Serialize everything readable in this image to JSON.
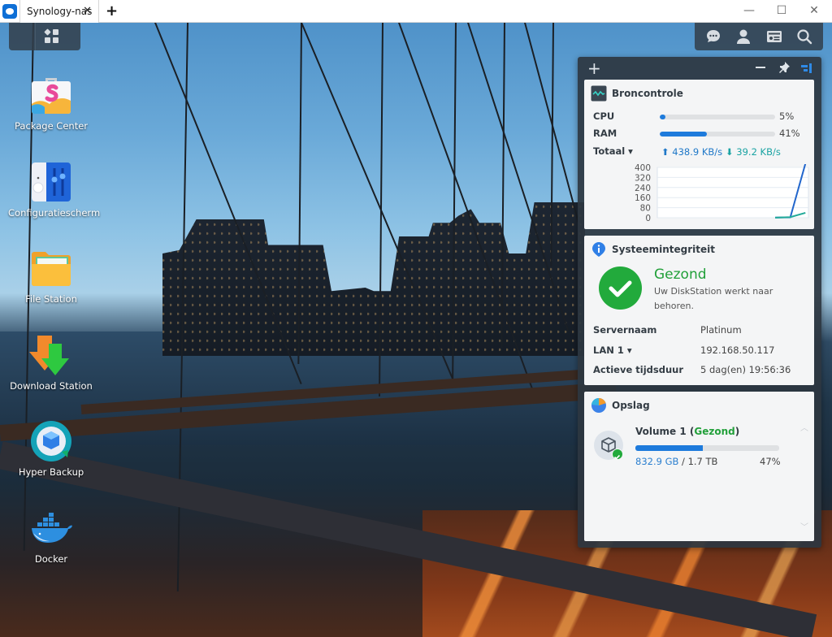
{
  "browser": {
    "tab_title": "Synology-nas",
    "tab_close": "✕",
    "new_tab": "+",
    "window_controls": {
      "minimize": "—",
      "maximize": "☐",
      "close": "✕"
    }
  },
  "taskbar": {
    "main_menu_icon": "grid-icon",
    "tray_icons": [
      "chat-icon",
      "user-icon",
      "widgets-icon",
      "search-icon"
    ]
  },
  "desktop_icons": [
    {
      "label": "Package Center",
      "icon": "package-center-icon"
    },
    {
      "label": "Configuratiescherm",
      "icon": "control-panel-icon"
    },
    {
      "label": "File Station",
      "icon": "file-station-icon"
    },
    {
      "label": "Download Station",
      "icon": "download-station-icon"
    },
    {
      "label": "Hyper Backup",
      "icon": "hyper-backup-icon"
    },
    {
      "label": "Docker",
      "icon": "docker-icon"
    }
  ],
  "widgets": {
    "controls": {
      "add": "+",
      "minimize": "minimize-icon",
      "pin": "pin-icon",
      "dock": "dock-icon"
    },
    "resource_monitor": {
      "title": "Broncontrole",
      "cpu_label": "CPU",
      "cpu_percent": 5,
      "cpu_text": "5%",
      "ram_label": "RAM",
      "ram_percent": 41,
      "ram_text": "41%",
      "total_label": "Totaal ▾",
      "upload": "438.9 KB/s",
      "download": "39.2 KB/s",
      "colors": {
        "bar": "#1e7bdc",
        "upload": "#1f78c8",
        "download": "#1aa3a3"
      }
    },
    "system_health": {
      "title": "Systeemintegriteit",
      "status": "Gezond",
      "description": "Uw DiskStation werkt naar behoren.",
      "rows": [
        {
          "label": "Servernaam",
          "value": "Platinum"
        },
        {
          "label": "LAN 1 ▾",
          "value": "192.168.50.117"
        },
        {
          "label": "Actieve tijdsduur",
          "value": "5 dag(en) 19:56:36"
        }
      ],
      "status_color": "#22a03a"
    },
    "storage": {
      "title": "Opslag",
      "volume_name": "Volume 1 (",
      "volume_status": "Gezond",
      "volume_close": ")",
      "used": "832.9 GB",
      "separator": " / ",
      "total": "1.7 TB",
      "percent": 47,
      "percent_text": "47%"
    }
  },
  "chart_data": {
    "type": "line",
    "title": "",
    "xlabel": "",
    "ylabel": "",
    "ylim": [
      0,
      400
    ],
    "yticks": [
      "400",
      "320",
      "240",
      "160",
      "80",
      "0"
    ],
    "grid": true,
    "series": [
      {
        "name": "upload",
        "color": "#2266cc",
        "values": [
          0,
          0,
          0,
          0,
          0,
          0,
          0,
          0,
          0,
          0,
          0,
          0,
          0,
          0,
          0,
          0,
          0,
          0,
          0,
          0,
          0,
          0,
          0,
          0,
          0,
          0,
          0,
          0,
          0,
          0,
          0,
          0,
          0,
          0,
          0,
          0,
          0,
          0,
          2,
          3,
          430
        ]
      },
      {
        "name": "download",
        "color": "#22aa99",
        "values": [
          0,
          0,
          0,
          0,
          0,
          0,
          0,
          0,
          0,
          0,
          0,
          0,
          0,
          0,
          0,
          0,
          0,
          0,
          0,
          0,
          0,
          0,
          0,
          0,
          0,
          0,
          0,
          0,
          0,
          0,
          0,
          0,
          0,
          0,
          0,
          0,
          0,
          0,
          1,
          5,
          39
        ]
      }
    ]
  }
}
